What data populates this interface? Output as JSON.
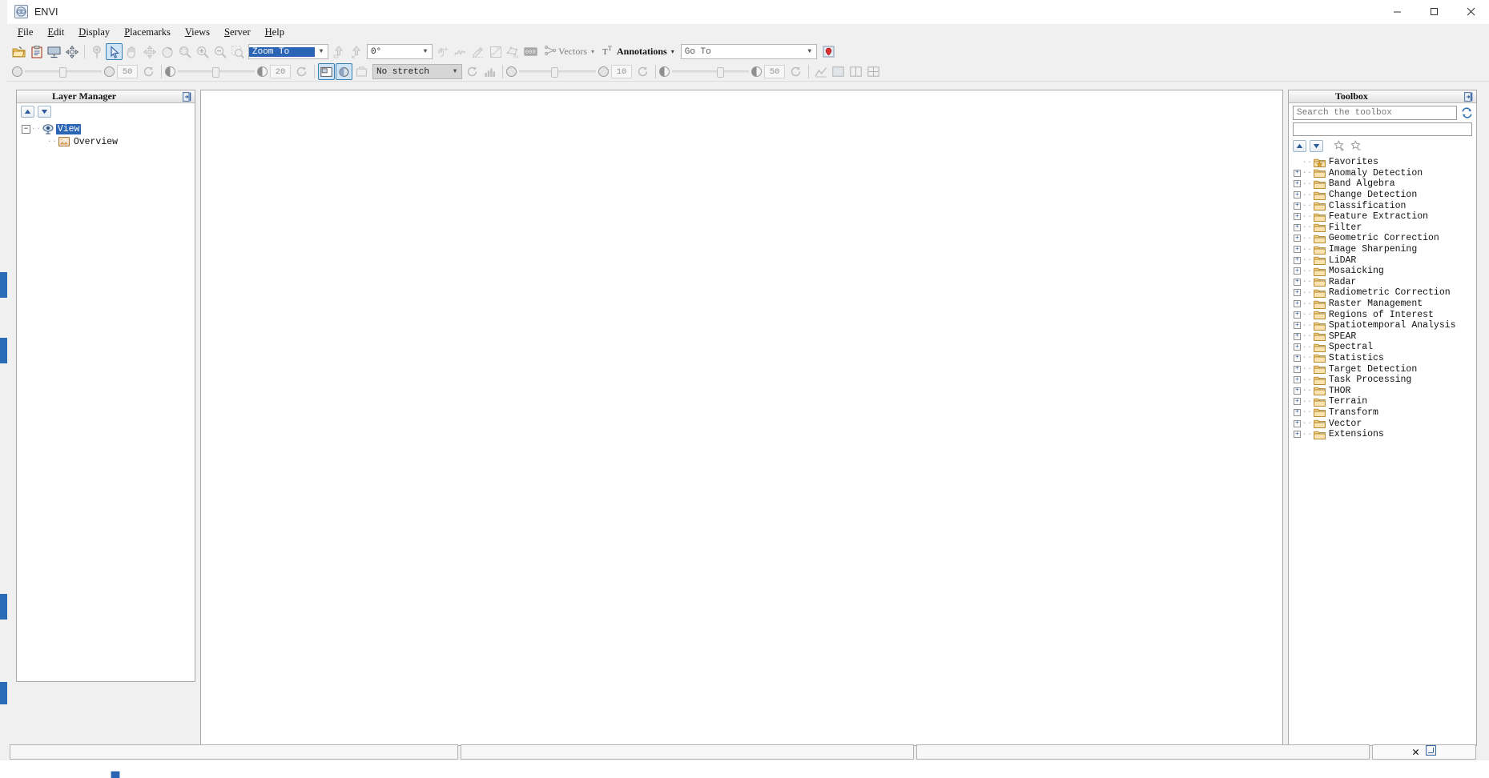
{
  "window": {
    "title": "ENVI",
    "app_icon": "envi-logo-icon",
    "minimize": "─",
    "maximize": "☐",
    "close": "✕"
  },
  "menubar": {
    "items": [
      {
        "label": "File",
        "mnemonic": "F"
      },
      {
        "label": "Edit",
        "mnemonic": "E"
      },
      {
        "label": "Display",
        "mnemonic": "D"
      },
      {
        "label": "Placemarks",
        "mnemonic": "P"
      },
      {
        "label": "Views",
        "mnemonic": "V"
      },
      {
        "label": "Server",
        "mnemonic": "S"
      },
      {
        "label": "Help",
        "mnemonic": "H"
      }
    ]
  },
  "toolbar1": {
    "buttons": [
      {
        "name": "open-file-icon",
        "tip": "Open",
        "state": "enabled"
      },
      {
        "name": "clipboard-icon",
        "tip": "Open Recent",
        "state": "enabled"
      },
      {
        "name": "display-screen-icon",
        "tip": "Data Manager",
        "state": "enabled"
      },
      {
        "name": "compass-arrows-icon",
        "tip": "Navigate",
        "state": "enabled"
      },
      {
        "name": "placemark-pin-icon",
        "tip": "Placemark",
        "state": "disabled"
      },
      {
        "name": "select-arrow-icon",
        "tip": "Select",
        "state": "active"
      },
      {
        "name": "pan-hand-icon",
        "tip": "Pan",
        "state": "disabled"
      },
      {
        "name": "fly-move-icon",
        "tip": "Fly",
        "state": "disabled"
      },
      {
        "name": "rotate-icon",
        "tip": "Rotate",
        "state": "disabled"
      },
      {
        "name": "zoom-fit-icon",
        "tip": "Zoom to Fit",
        "state": "disabled"
      },
      {
        "name": "zoom-in-icon",
        "tip": "Zoom In",
        "state": "disabled"
      },
      {
        "name": "zoom-out-icon",
        "tip": "Zoom Out",
        "state": "disabled"
      },
      {
        "name": "zoom-region-icon",
        "tip": "Zoom to Region",
        "state": "disabled"
      }
    ],
    "zoom_combo": {
      "value": "Zoom To",
      "selected": true
    },
    "after_zoom_buttons": [
      {
        "name": "north-up-icon",
        "tip": "North Up",
        "state": "disabled"
      },
      {
        "name": "rotate-north-icon",
        "tip": "Rotate to North",
        "state": "disabled"
      }
    ],
    "rotation_combo": {
      "value": "0°"
    },
    "tool_buttons": [
      {
        "name": "crosshair-cursor-icon",
        "tip": "Cursor Value",
        "state": "disabled"
      },
      {
        "name": "spectral-profile-icon",
        "tip": "Spectral Profile",
        "state": "disabled"
      },
      {
        "name": "pencil-measure-icon",
        "tip": "Mensuration",
        "state": "disabled"
      },
      {
        "name": "scatter-plot-icon",
        "tip": "2D Scatter Plot",
        "state": "disabled"
      },
      {
        "name": "roi-tool-icon",
        "tip": "Region of Interest",
        "state": "disabled"
      },
      {
        "name": "pixel-counter-icon",
        "tip": "Pixel Counter",
        "state": "disabled"
      }
    ],
    "vectors": {
      "label": "Vectors",
      "caret": "▾",
      "icon": "vector-node-icon"
    },
    "annotations": {
      "label": "Annotations",
      "caret": "▾",
      "icon": "text-annotation-icon"
    },
    "goto": {
      "placeholder": "Go To",
      "value": ""
    },
    "goto_action": {
      "name": "goto-marker-icon",
      "tip": "Go To"
    }
  },
  "toolbar2": {
    "transparency": {
      "label": "Transparency",
      "value": "50",
      "thumb_pct": 50
    },
    "transparency_reset": {
      "name": "reset-transparency-icon"
    },
    "brightness": {
      "label": "Brightness",
      "value": "20",
      "thumb_pct": 50
    },
    "portal_buttons": [
      {
        "name": "portal-view-icon",
        "tip": "Portal",
        "state": "active"
      },
      {
        "name": "blend-portal-icon",
        "tip": "Blend",
        "state": "active"
      },
      {
        "name": "flicker-icon",
        "tip": "Flicker",
        "state": "disabled"
      }
    ],
    "stretch_combo": {
      "value": "No stretch"
    },
    "stretch_reset": {
      "name": "reset-stretch-icon"
    },
    "histogram_button": {
      "name": "histogram-icon",
      "tip": "Histogram Stretch"
    },
    "contrast": {
      "label": "Contrast",
      "value": "10",
      "thumb_pct": 48
    },
    "contrast_reset": {
      "name": "reset-contrast-icon"
    },
    "sharpen": {
      "label": "Sharpen",
      "value": "50",
      "thumb_pct": 62
    },
    "sharpen_reset": {
      "name": "reset-sharpen-icon"
    },
    "end_buttons": [
      {
        "name": "chart-line-icon",
        "tip": "Profile"
      },
      {
        "name": "view-single-icon",
        "tip": "Single View"
      },
      {
        "name": "view-two-icon",
        "tip": "Two Views"
      },
      {
        "name": "view-grid-icon",
        "tip": "Grid Views"
      }
    ]
  },
  "layer_manager": {
    "title": "Layer Manager",
    "pin_icon": "pin-panel-icon",
    "move_up": "▲",
    "move_down": "▼",
    "tree": [
      {
        "label": "View",
        "icon": "view-eye-icon",
        "expander": "−",
        "selected": true,
        "children": [
          {
            "label": "Overview",
            "icon": "overview-image-icon",
            "expander": "",
            "selected": false
          }
        ]
      }
    ]
  },
  "toolbox": {
    "title": "Toolbox",
    "pin_icon": "pin-panel-icon",
    "search": {
      "placeholder": "Search the toolbox",
      "value": ""
    },
    "refresh_icon": "refresh-icon",
    "filter": {
      "value": ""
    },
    "move_up": "▲",
    "move_down": "▼",
    "add_favorite_icon": "star-add-icon",
    "remove_favorite_icon": "star-remove-icon",
    "tree": [
      {
        "label": "Favorites",
        "expandable": false,
        "icon": "favorites-folder-icon"
      },
      {
        "label": "Anomaly Detection",
        "expandable": true,
        "icon": "folder-icon"
      },
      {
        "label": "Band Algebra",
        "expandable": true,
        "icon": "folder-icon"
      },
      {
        "label": "Change Detection",
        "expandable": true,
        "icon": "folder-icon"
      },
      {
        "label": "Classification",
        "expandable": true,
        "icon": "folder-icon"
      },
      {
        "label": "Feature Extraction",
        "expandable": true,
        "icon": "folder-icon"
      },
      {
        "label": "Filter",
        "expandable": true,
        "icon": "folder-icon"
      },
      {
        "label": "Geometric Correction",
        "expandable": true,
        "icon": "folder-icon"
      },
      {
        "label": "Image Sharpening",
        "expandable": true,
        "icon": "folder-icon"
      },
      {
        "label": "LiDAR",
        "expandable": true,
        "icon": "folder-icon"
      },
      {
        "label": "Mosaicking",
        "expandable": true,
        "icon": "folder-icon"
      },
      {
        "label": "Radar",
        "expandable": true,
        "icon": "folder-icon"
      },
      {
        "label": "Radiometric Correction",
        "expandable": true,
        "icon": "folder-icon"
      },
      {
        "label": "Raster Management",
        "expandable": true,
        "icon": "folder-icon"
      },
      {
        "label": "Regions of Interest",
        "expandable": true,
        "icon": "folder-icon"
      },
      {
        "label": "Spatiotemporal Analysis",
        "expandable": true,
        "icon": "folder-icon"
      },
      {
        "label": "SPEAR",
        "expandable": true,
        "icon": "folder-icon"
      },
      {
        "label": "Spectral",
        "expandable": true,
        "icon": "folder-icon"
      },
      {
        "label": "Statistics",
        "expandable": true,
        "icon": "folder-icon"
      },
      {
        "label": "Target Detection",
        "expandable": true,
        "icon": "folder-icon"
      },
      {
        "label": "Task Processing",
        "expandable": true,
        "icon": "folder-icon"
      },
      {
        "label": "THOR",
        "expandable": true,
        "icon": "folder-icon"
      },
      {
        "label": "Terrain",
        "expandable": true,
        "icon": "folder-icon"
      },
      {
        "label": "Transform",
        "expandable": true,
        "icon": "folder-icon"
      },
      {
        "label": "Vector",
        "expandable": true,
        "icon": "folder-icon"
      },
      {
        "label": "Extensions",
        "expandable": true,
        "icon": "folder-icon"
      }
    ]
  },
  "statusbar": {
    "cell1": "",
    "cell2": "",
    "cell3": "",
    "close_icon": "close-status-icon",
    "resize_icon": "resize-grip-icon"
  },
  "colors": {
    "accent": "#2a64b4",
    "selection": "#2a64b4",
    "panel_bg": "#f0f0f0",
    "desktop_edge": "#2a6bb5"
  }
}
